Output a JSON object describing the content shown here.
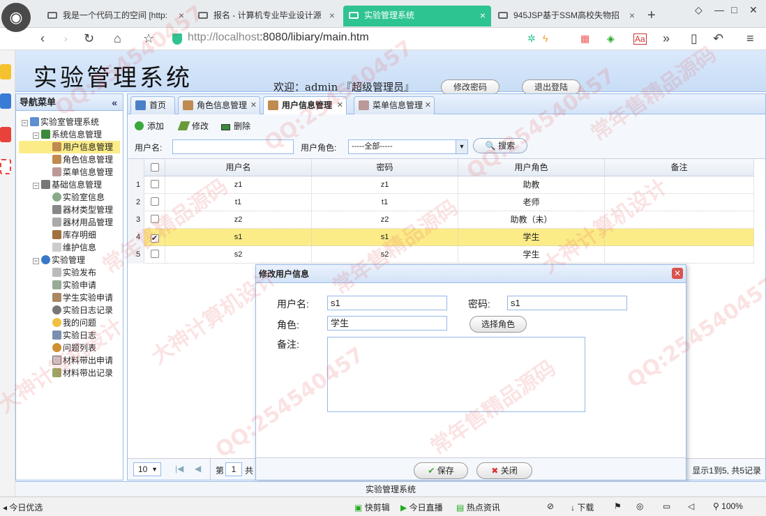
{
  "browser": {
    "tabs": [
      {
        "label": "我是一个代码工的空间 [http:"
      },
      {
        "label": "报名 - 计算机专业毕业设计源"
      },
      {
        "label": "实验管理系统"
      },
      {
        "label": "945JSP基于SSM高校失物招"
      }
    ],
    "url_host": "http://localhost",
    "url_rest": ":8080/libiary/main.htm"
  },
  "app": {
    "title": "实验管理系统",
    "welcome": "欢迎：admin 『超级管理员』",
    "change_password": "修改密码",
    "logout": "退出登陆",
    "footer": "实验管理系统"
  },
  "nav": {
    "title": "导航菜单",
    "collapse": "«",
    "root": "实验室管理系统",
    "groups": [
      {
        "label": "系统信息管理",
        "items": [
          "用户信息管理",
          "角色信息管理",
          "菜单信息管理"
        ]
      },
      {
        "label": "基础信息管理",
        "items": [
          "实验室信息",
          "器材类型管理",
          "器材用品管理",
          "库存明细",
          "维护信息"
        ]
      },
      {
        "label": "实验管理",
        "items": [
          "实验发布",
          "实验申请",
          "学生实验申请",
          "实验日志记录",
          "我的问题",
          "实验日志",
          "问题列表",
          "材料带出申请",
          "材料带出记录"
        ]
      }
    ]
  },
  "tabs": [
    "首页",
    "角色信息管理",
    "用户信息管理",
    "菜单信息管理"
  ],
  "toolbar": {
    "add": "添加",
    "edit": "修改",
    "delete": "删除",
    "username_label": "用户名:",
    "username_value": "",
    "role_label": "用户角色:",
    "role_value": "-----全部-----",
    "search": "搜索"
  },
  "grid": {
    "columns": [
      "用户名",
      "密码",
      "用户角色",
      "备注"
    ],
    "rows": [
      {
        "n": "1",
        "checked": false,
        "user": "z1",
        "pwd": "z1",
        "role": "助教",
        "note": ""
      },
      {
        "n": "2",
        "checked": false,
        "user": "t1",
        "pwd": "t1",
        "role": "老师",
        "note": ""
      },
      {
        "n": "3",
        "checked": false,
        "user": "z2",
        "pwd": "z2",
        "role": "助教（未）",
        "note": ""
      },
      {
        "n": "4",
        "checked": true,
        "user": "s1",
        "pwd": "s1",
        "role": "学生",
        "note": ""
      },
      {
        "n": "5",
        "checked": false,
        "user": "s2",
        "pwd": "s2",
        "role": "学生",
        "note": ""
      }
    ]
  },
  "pager": {
    "page_size": "10",
    "page_prefix": "第",
    "page": "1",
    "page_suffix": "共",
    "summary": "显示1到5, 共5记录"
  },
  "dialog": {
    "title": "修改用户信息",
    "username_label": "用户名:",
    "username": "s1",
    "password_label": "密码:",
    "password": "s1",
    "role_label": "角色:",
    "role": "学生",
    "choose_role": "选择角色",
    "note_label": "备注:",
    "note": "",
    "save": "保存",
    "close": "关闭"
  },
  "statusbar": {
    "left": "今日优选",
    "items": [
      "快剪辑",
      "今日直播",
      "热点资讯",
      "下载"
    ],
    "zoom": "100%"
  },
  "watermarks": [
    "QQ:254540457",
    "常年售精品源码",
    "大神计算机设计"
  ]
}
